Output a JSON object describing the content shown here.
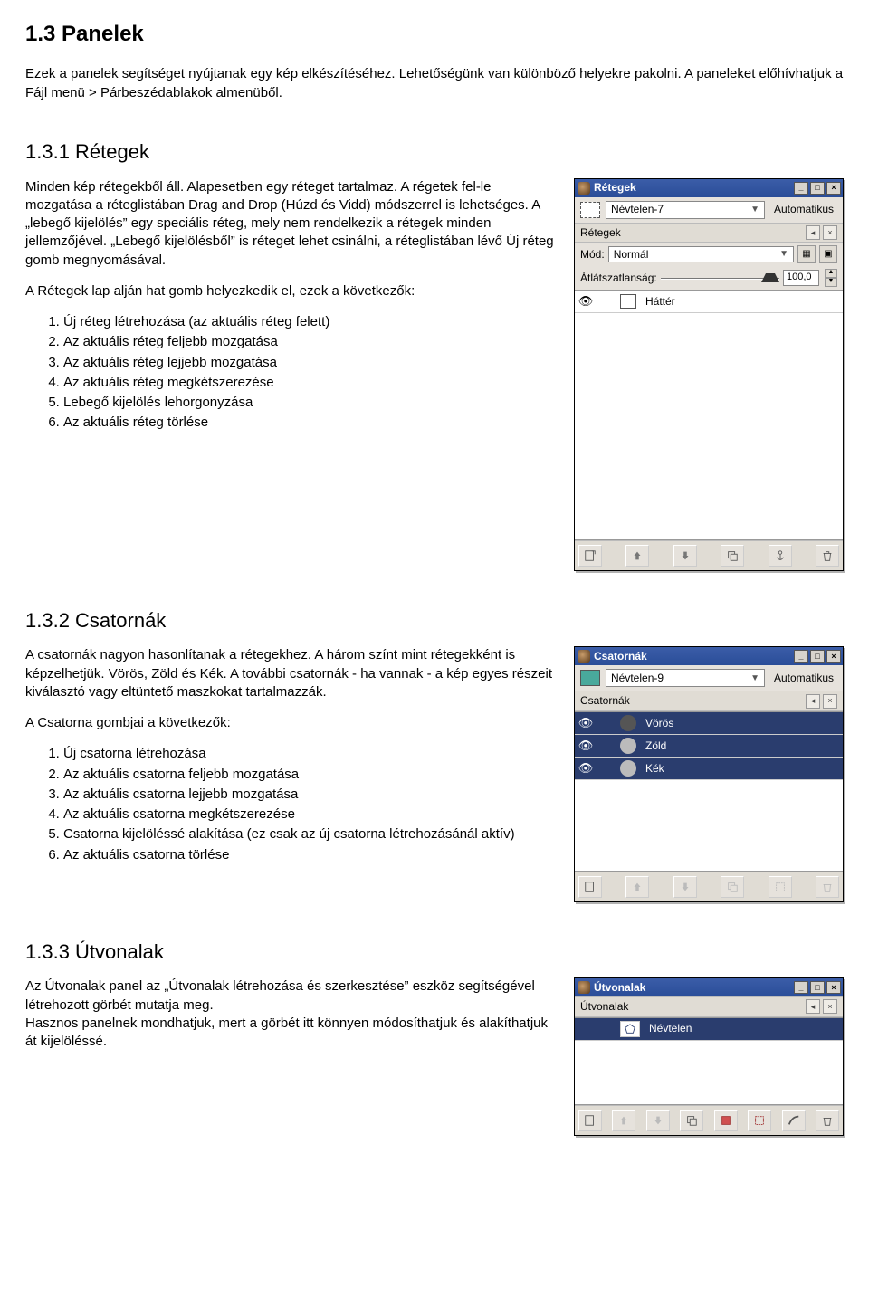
{
  "doc": {
    "h1": "1.3 Panelek",
    "intro": "Ezek a panelek segítséget nyújtanak egy kép elkészítéséhez. Lehetőségünk van különböző helyekre pakolni. A paneleket előhívhatjuk a Fájl  menü > Párbeszédablakok almenüből.",
    "s131_title": "1.3.1 Rétegek",
    "s131_body1": "Minden kép rétegekből áll. Alapesetben egy réteget tartalmaz. A régetek fel-le mozgatása a réteglistában Drag and Drop (Húzd és Vidd) módszerrel is lehetséges.",
    "s131_body2": "A „lebegő kijelölés” egy speciális réteg, mely nem rendelkezik a rétegek minden jellemzőjével. „Lebegő kijelölésből”  is réteget lehet csinálni, a réteglistában lévő Új réteg gomb megnyomásával.",
    "s131_body3": "A Rétegek lap alján hat gomb helyezkedik el, ezek a következők:",
    "s131_list": [
      "Új réteg létrehozása (az aktuális réteg felett)",
      "Az aktuális réteg feljebb mozgatása",
      "Az aktuális réteg lejjebb mozgatása",
      "Az aktuális réteg megkétszerezése",
      "Lebegő kijelölés lehorgonyzása",
      "Az aktuális réteg törlése"
    ],
    "s132_title": "1.3.2 Csatornák",
    "s132_body1": "A csatornák nagyon hasonlítanak a rétegekhez. A három színt mint rétegekként is képzelhetjük. Vörös, Zöld és Kék. A további csatornák - ha vannak - a kép egyes részeit kiválasztó vagy eltüntető maszkokat tartalmazzák.",
    "s132_body2": "A Csatorna gombjai a következők:",
    "s132_list": [
      "Új csatorna létrehozása",
      "Az aktuális csatorna feljebb mozgatása",
      "Az aktuális csatorna lejjebb mozgatása",
      "Az aktuális csatorna megkétszerezése",
      "Csatorna kijelöléssé alakítása (ez csak az új csatorna létrehozásánál aktív)",
      "Az aktuális csatorna törlése"
    ],
    "s133_title": "1.3.3 Útvonalak",
    "s133_body": "Az Útvonalak panel az „Útvonalak létrehozása és szerkesztése” eszköz segítségével létrehozott görbét mutatja meg.\nHasznos panelnek mondhatjuk, mert a görbét itt könnyen módosíthatjuk és alakíthatjuk át kijelöléssé."
  },
  "layers_panel": {
    "title": "Rétegek",
    "image_name": "Névtelen-7",
    "auto": "Automatikus",
    "section_label": "Rétegek",
    "mode_label": "Mód:",
    "mode_value": "Normál",
    "opacity_label": "Átlátszatlanság:",
    "opacity_value": "100,0",
    "layers": [
      {
        "name": "Háttér"
      }
    ]
  },
  "channels_panel": {
    "title": "Csatornák",
    "image_name": "Névtelen-9",
    "auto": "Automatikus",
    "section_label": "Csatornák",
    "channels": [
      {
        "name": "Vörös"
      },
      {
        "name": "Zöld"
      },
      {
        "name": "Kék"
      }
    ]
  },
  "paths_panel": {
    "title": "Útvonalak",
    "section_label": "Útvonalak",
    "paths": [
      {
        "name": "Névtelen"
      }
    ]
  },
  "window_controls": {
    "minimize": "_",
    "maximize": "□",
    "close": "×"
  }
}
